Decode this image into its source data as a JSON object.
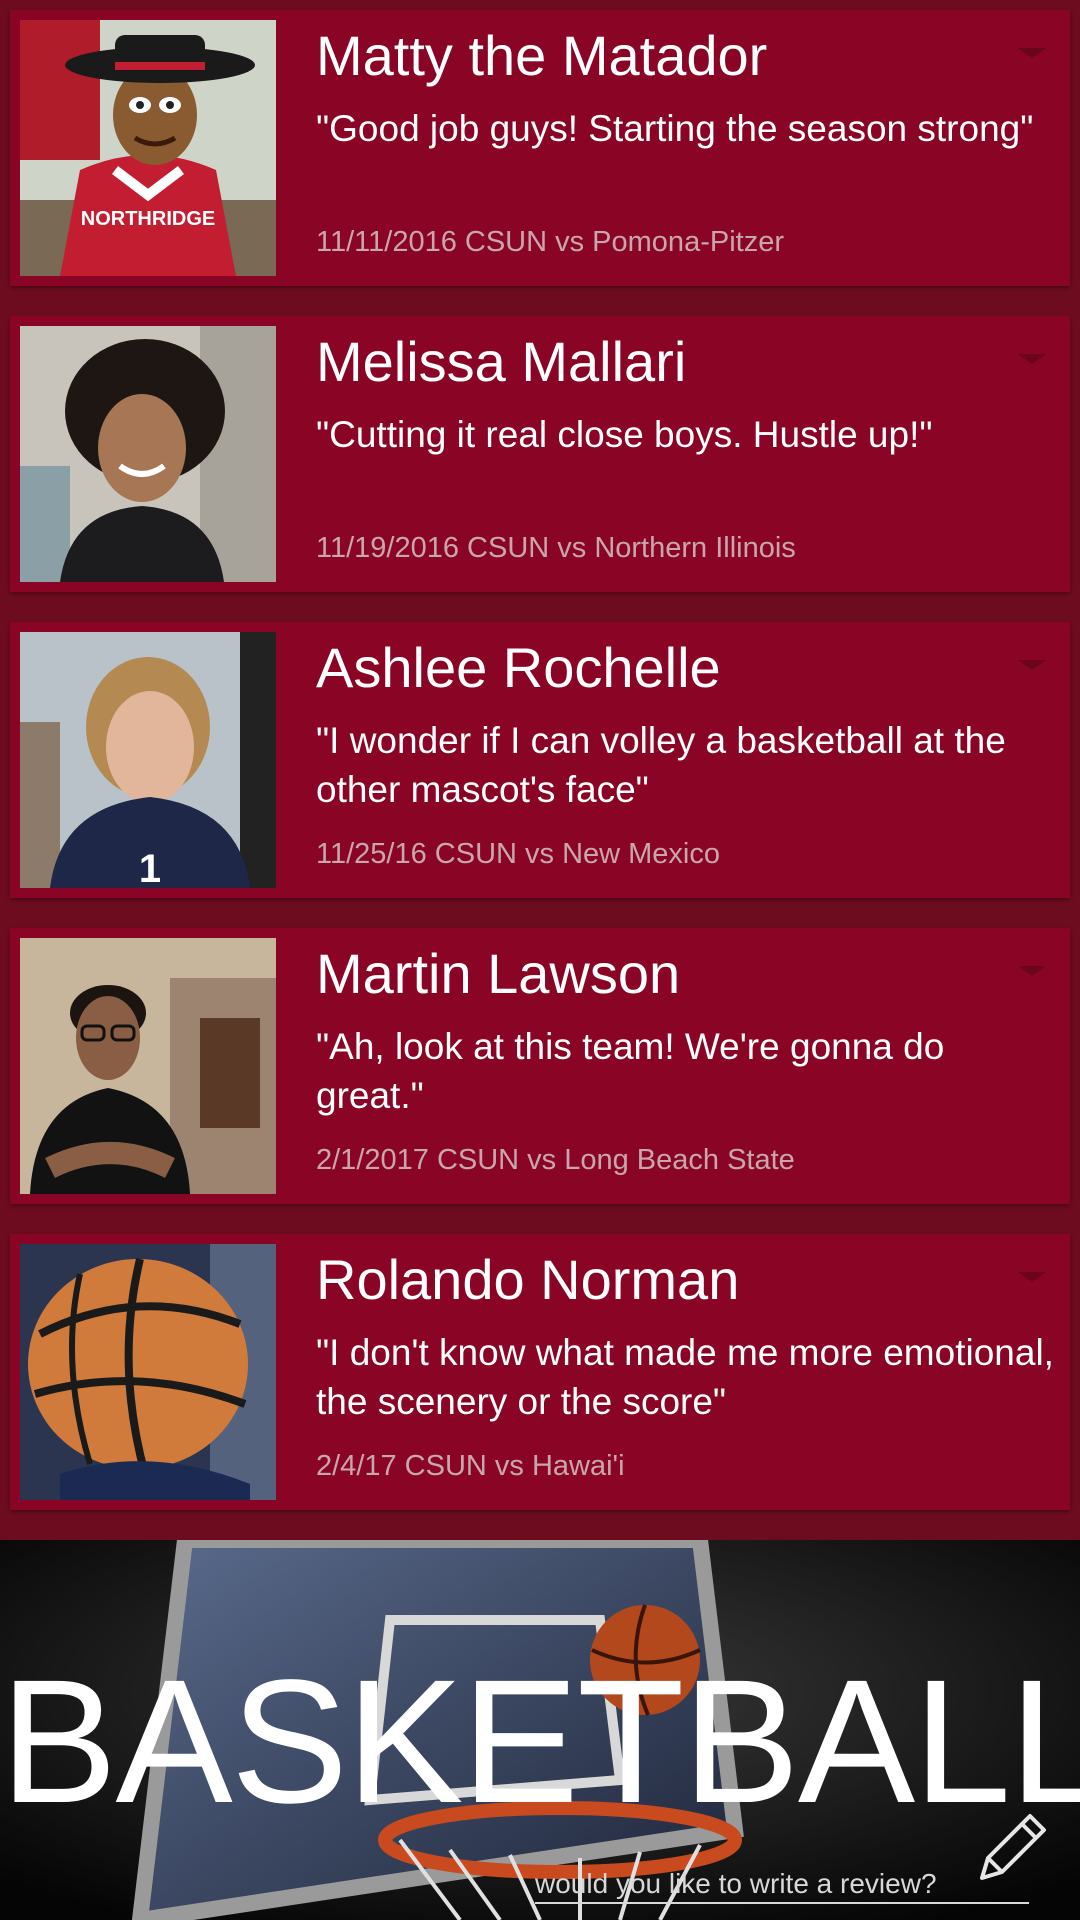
{
  "reviews": [
    {
      "name": "Matty the Matador",
      "quote": "\"Good job guys! Starting the season strong\"",
      "meta": "11/11/2016 CSUN vs Pomona-Pitzer",
      "photo_icon": "mascot-photo"
    },
    {
      "name": "Melissa Mallari",
      "quote": "\"Cutting it real close boys. Hustle up!\"",
      "meta": "11/19/2016 CSUN vs Northern Illinois",
      "photo_icon": "person-photo"
    },
    {
      "name": "Ashlee Rochelle",
      "quote": "\"I wonder if I can volley a basketball at the other mascot's face\"",
      "meta": "11/25/16 CSUN vs New Mexico",
      "photo_icon": "person-photo"
    },
    {
      "name": "Martin Lawson",
      "quote": "\"Ah, look at this team! We're gonna do great.\"",
      "meta": "2/1/2017 CSUN vs Long Beach State",
      "photo_icon": "person-photo"
    },
    {
      "name": "Rolando Norman",
      "quote": "\"I don't know what made me more emotional, the scenery or the score\"",
      "meta": "2/4/17 CSUN vs Hawai'i",
      "photo_icon": "fan-photo"
    }
  ],
  "banner": {
    "title": "BASKETBALL",
    "review_prompt": "would you like to write a review?",
    "icon": "pencil-icon"
  },
  "colors": {
    "card": "#8a0525",
    "background": "#6e0c1f",
    "meta_text": "#c9a6ad",
    "banner_bg": "#0d0d0d"
  }
}
